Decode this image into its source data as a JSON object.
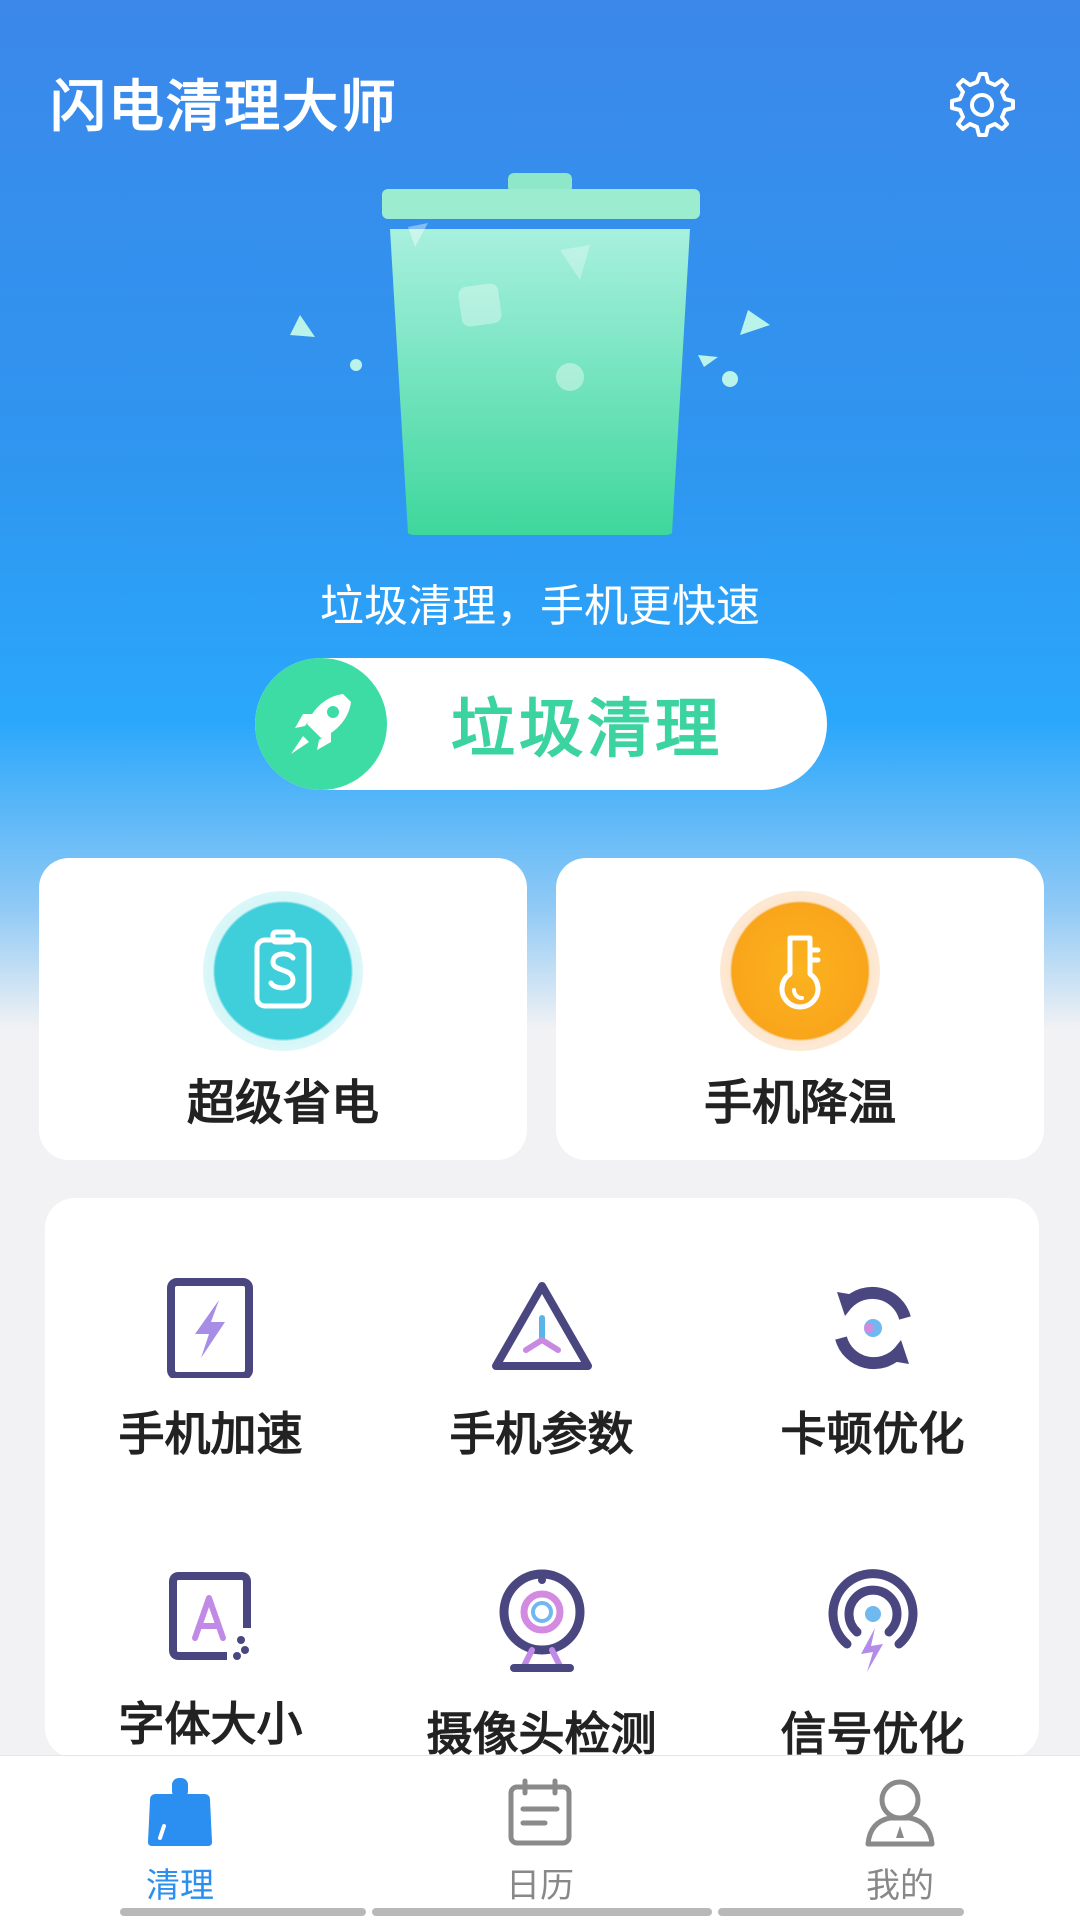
{
  "app_title": "闪电清理大师",
  "hero": {
    "slogan": "垃圾清理，手机更快速",
    "clean_button_label": "垃圾清理"
  },
  "cards": [
    {
      "label": "超级省电",
      "icon": "battery-s-icon",
      "color": "#38cfd8"
    },
    {
      "label": "手机降温",
      "icon": "thermometer-icon",
      "color": "#fba51c"
    }
  ],
  "tools": [
    {
      "label": "手机加速",
      "icon": "lightning-phone-icon"
    },
    {
      "label": "手机参数",
      "icon": "triangle-params-icon"
    },
    {
      "label": "卡顿优化",
      "icon": "refresh-optimize-icon"
    },
    {
      "label": "字体大小",
      "icon": "font-size-icon"
    },
    {
      "label": "摄像头检测",
      "icon": "camera-detect-icon"
    },
    {
      "label": "信号优化",
      "icon": "signal-optimize-icon"
    }
  ],
  "tabbar": [
    {
      "label": "清理",
      "icon": "broom-icon",
      "active": true
    },
    {
      "label": "日历",
      "icon": "calendar-icon",
      "active": false
    },
    {
      "label": "我的",
      "icon": "profile-icon",
      "active": false
    }
  ],
  "colors": {
    "brand_blue": "#2a8ff0",
    "clean_green": "#3ddca5",
    "icon_purple": "#4a4680"
  }
}
